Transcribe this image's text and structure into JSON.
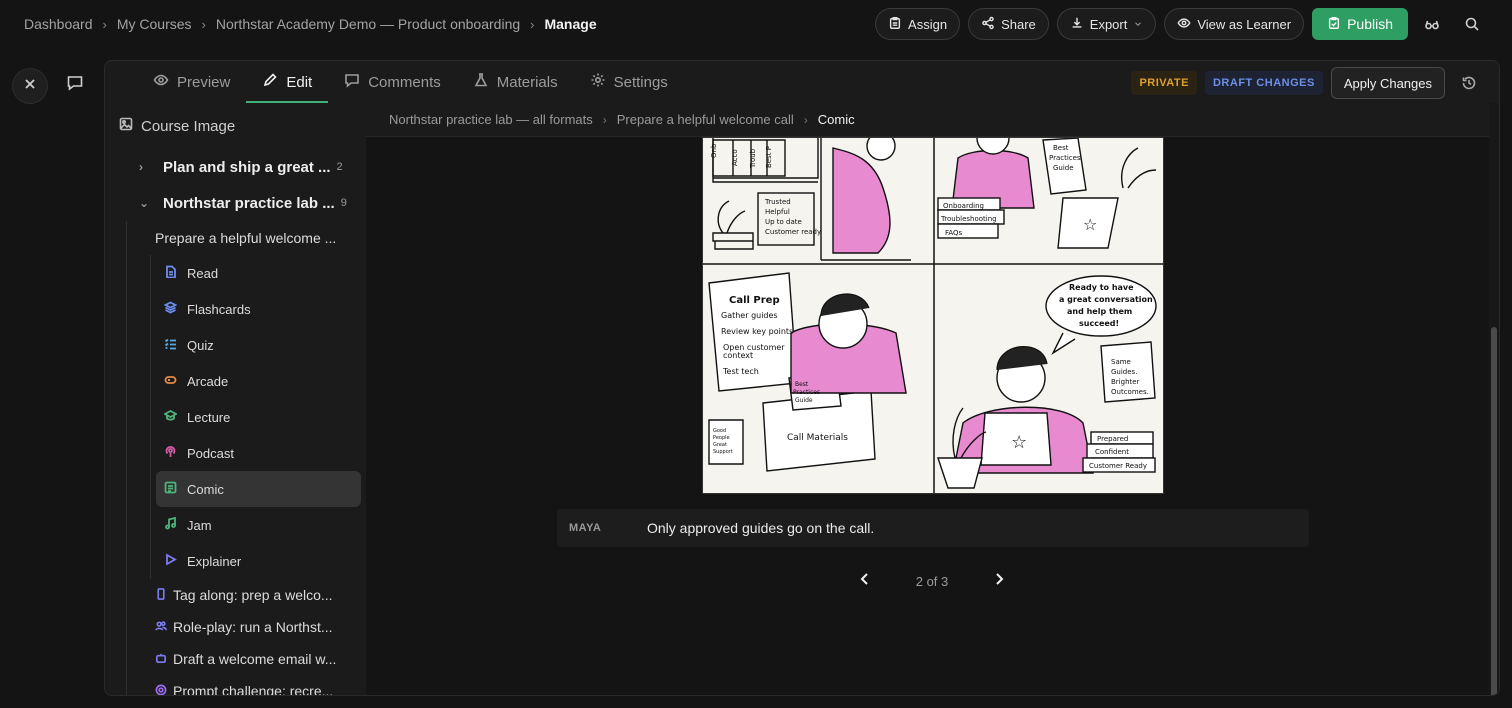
{
  "breadcrumb": [
    "Dashboard",
    "My Courses",
    "Northstar Academy Demo — Product onboarding",
    "Manage"
  ],
  "top_actions": {
    "assign": "Assign",
    "share": "Share",
    "export": "Export",
    "view_as_learner": "View as Learner",
    "publish": "Publish"
  },
  "tabs": [
    {
      "label": "Preview",
      "icon": "eye-icon",
      "active": false
    },
    {
      "label": "Edit",
      "icon": "pencil-icon",
      "active": true
    },
    {
      "label": "Comments",
      "icon": "comment-icon",
      "active": false
    },
    {
      "label": "Materials",
      "icon": "flask-icon",
      "active": false
    },
    {
      "label": "Settings",
      "icon": "gear-icon",
      "active": false
    }
  ],
  "status": {
    "private": "PRIVATE",
    "draft": "DRAFT CHANGES",
    "apply": "Apply Changes"
  },
  "sidebar": {
    "head": "Course Image",
    "sections": [
      {
        "title": "Plan and ship a great ...",
        "count": "2",
        "expanded": false
      },
      {
        "title": "Northstar practice lab ...",
        "count": "9",
        "expanded": true
      }
    ],
    "lesson": "Prepare a helpful welcome ...",
    "items": [
      {
        "label": "Read",
        "icon": "document-icon",
        "color": "#6c8cf0"
      },
      {
        "label": "Flashcards",
        "icon": "layers-icon",
        "color": "#6c8cf0"
      },
      {
        "label": "Quiz",
        "icon": "checklist-icon",
        "color": "#5aa8e0"
      },
      {
        "label": "Arcade",
        "icon": "gamepad-icon",
        "color": "#e08a4a"
      },
      {
        "label": "Lecture",
        "icon": "graduation-icon",
        "color": "#4fb27a"
      },
      {
        "label": "Podcast",
        "icon": "podcast-icon",
        "color": "#d45ca8"
      },
      {
        "label": "Comic",
        "icon": "image-icon",
        "color": "#4fb27a",
        "selected": true
      },
      {
        "label": "Jam",
        "icon": "music-icon",
        "color": "#4fb27a"
      },
      {
        "label": "Explainer",
        "icon": "play-icon",
        "color": "#7b7bf0"
      }
    ],
    "extras": [
      {
        "label": "Tag along: prep a welco...",
        "icon": "phone-icon",
        "color": "#7b7bf0"
      },
      {
        "label": "Role-play: run a Northst...",
        "icon": "users-icon",
        "color": "#7b7bf0"
      },
      {
        "label": "Draft a welcome email w...",
        "icon": "bot-icon",
        "color": "#7b7bf0"
      },
      {
        "label": "Prompt challenge: recre...",
        "icon": "target-icon",
        "color": "#9a6cf0"
      }
    ]
  },
  "content": {
    "crumb": [
      "Northstar practice lab — all formats",
      "Prepare a helpful welcome call",
      "Comic"
    ],
    "comic": {
      "panel1_note": [
        "Trusted",
        "Helpful",
        "Up to date",
        "Customer ready"
      ],
      "panel1_binders": [
        "Onb",
        "Acco",
        "Troub",
        "Best P"
      ],
      "panel2_guide": [
        "Best",
        "Practices",
        "Guide"
      ],
      "panel2_books": [
        "Onboarding",
        "Troubleshooting",
        "FAQs"
      ],
      "panel3_title": "Call Prep",
      "panel3_checklist": [
        "Gather guides",
        "Review key points",
        "Open customer",
        "context",
        "Test tech"
      ],
      "panel3_mug": [
        "Good",
        "People",
        "Great",
        "Support"
      ],
      "panel3_guide": [
        "Best",
        "Practices",
        "Guide"
      ],
      "panel3_box": "Call Materials",
      "panel4_bubble": [
        "Ready to have",
        "a great conversation",
        "and help them",
        "succeed!"
      ],
      "panel4_note": [
        "Same",
        "Guides.",
        "Brighter",
        "Outcomes."
      ],
      "panel4_books": [
        "Prepared",
        "Confident",
        "Customer Ready"
      ]
    },
    "caption_speaker": "MAYA",
    "caption_line": "Only approved guides go on the call.",
    "pager": "2 of 3"
  }
}
